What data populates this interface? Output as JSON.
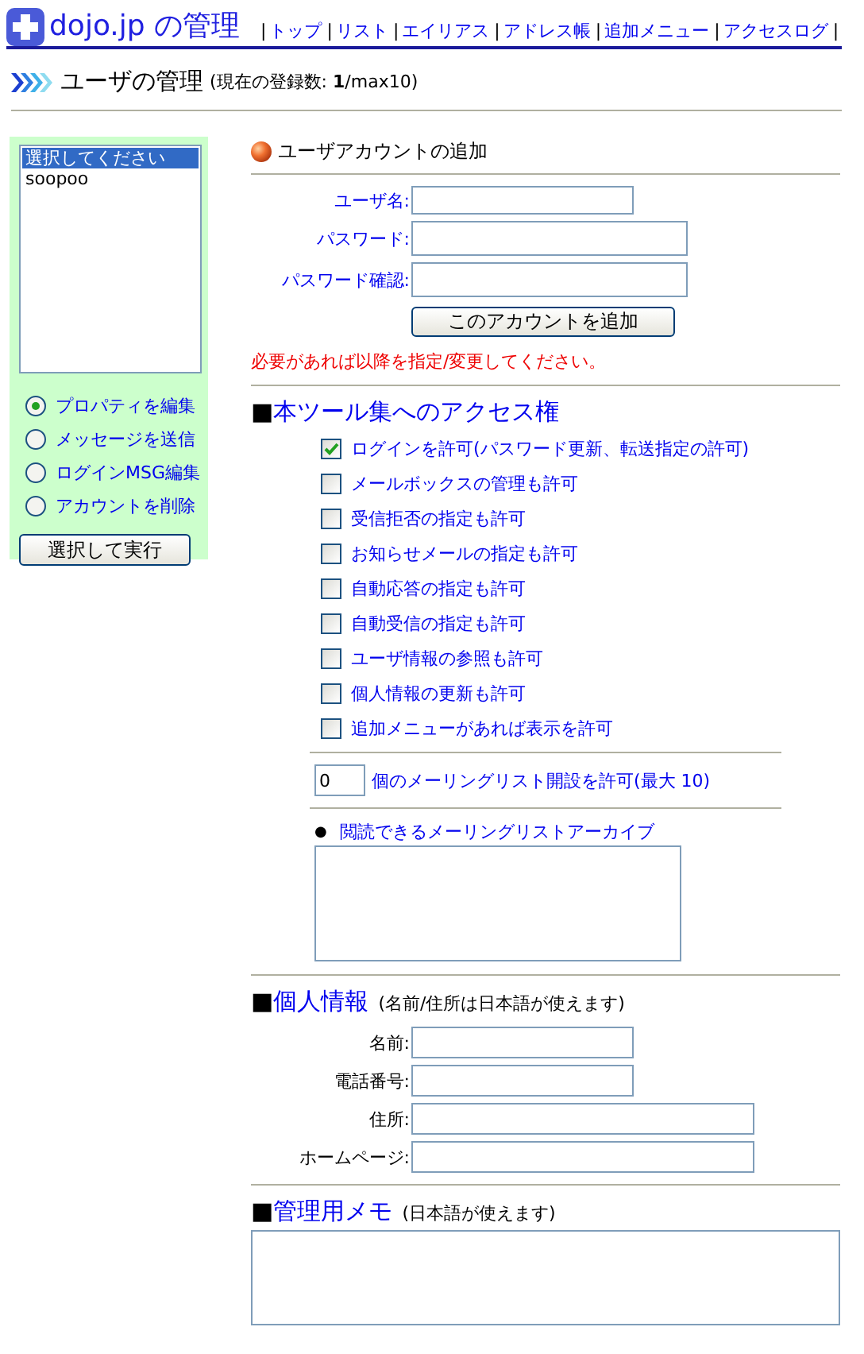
{
  "header": {
    "logo_text": "dojo.jp の管理",
    "nav": [
      {
        "separator": "|",
        "label": "トップ"
      },
      {
        "separator": "|",
        "label": "リスト"
      },
      {
        "separator": "|",
        "label": "エイリアス"
      },
      {
        "separator": "|",
        "label": "アドレス帳"
      },
      {
        "separator": "|",
        "label": "追加メニュー"
      },
      {
        "separator": "|",
        "label": "アクセスログ"
      }
    ],
    "nav_end": "|"
  },
  "page_title": {
    "title": "ユーザの管理",
    "note": "(現在の登録数: **1**/max10)"
  },
  "sidebar": {
    "users": [
      {
        "text": "選択してください",
        "selected": true
      },
      {
        "text": "soopoo",
        "selected": false
      }
    ],
    "actions": [
      {
        "label": "プロパティを編集",
        "selected": true
      },
      {
        "label": "メッセージを送信",
        "selected": false
      },
      {
        "label": "ログインMSG編集",
        "selected": false
      },
      {
        "label": "アカウントを削除",
        "selected": false
      }
    ],
    "button": "選択して実行"
  },
  "add_account": {
    "heading": "ユーザアカウントの追加",
    "fields": [
      {
        "label": "ユーザ名:",
        "kind": "short"
      },
      {
        "label": "パスワード:",
        "kind": "long"
      },
      {
        "label": "パスワード確認:",
        "kind": "long"
      }
    ],
    "button": "このアカウントを追加",
    "notice": "必要があれば以降を指定/変更してください。"
  },
  "access": {
    "bullet": "■",
    "title": "本ツール集へのアクセス権",
    "permissions": [
      {
        "label": "ログインを許可(パスワード更新、転送指定の許可)",
        "checked": true
      },
      {
        "label": "メールボックスの管理も許可",
        "checked": false
      },
      {
        "label": "受信拒否の指定も許可",
        "checked": false
      },
      {
        "label": "お知らせメールの指定も許可",
        "checked": false
      },
      {
        "label": "自動応答の指定も許可",
        "checked": false
      },
      {
        "label": "自動受信の指定も許可",
        "checked": false
      },
      {
        "label": "ユーザ情報の参照も許可",
        "checked": false
      },
      {
        "label": "個人情報の更新も許可",
        "checked": false
      },
      {
        "label": "追加メニューがあれば表示を許可",
        "checked": false
      }
    ],
    "mailing_lists": {
      "value": "0",
      "label": "個のメーリングリスト開設を許可(最大 10)"
    },
    "archive": {
      "bullet": "●",
      "label": "閲読できるメーリングリストアーカイブ"
    }
  },
  "personal": {
    "bullet": "■",
    "title": "個人情報",
    "note": "(名前/住所は日本語が使えます)",
    "fields": [
      {
        "label": "名前:",
        "kind": "short"
      },
      {
        "label": "電話番号:",
        "kind": "short"
      },
      {
        "label": "住所:",
        "kind": "long"
      },
      {
        "label": "ホームページ:",
        "kind": "long"
      }
    ]
  },
  "memo": {
    "bullet": "■",
    "title": "管理用メモ",
    "note": "(日本語が使えます)"
  }
}
